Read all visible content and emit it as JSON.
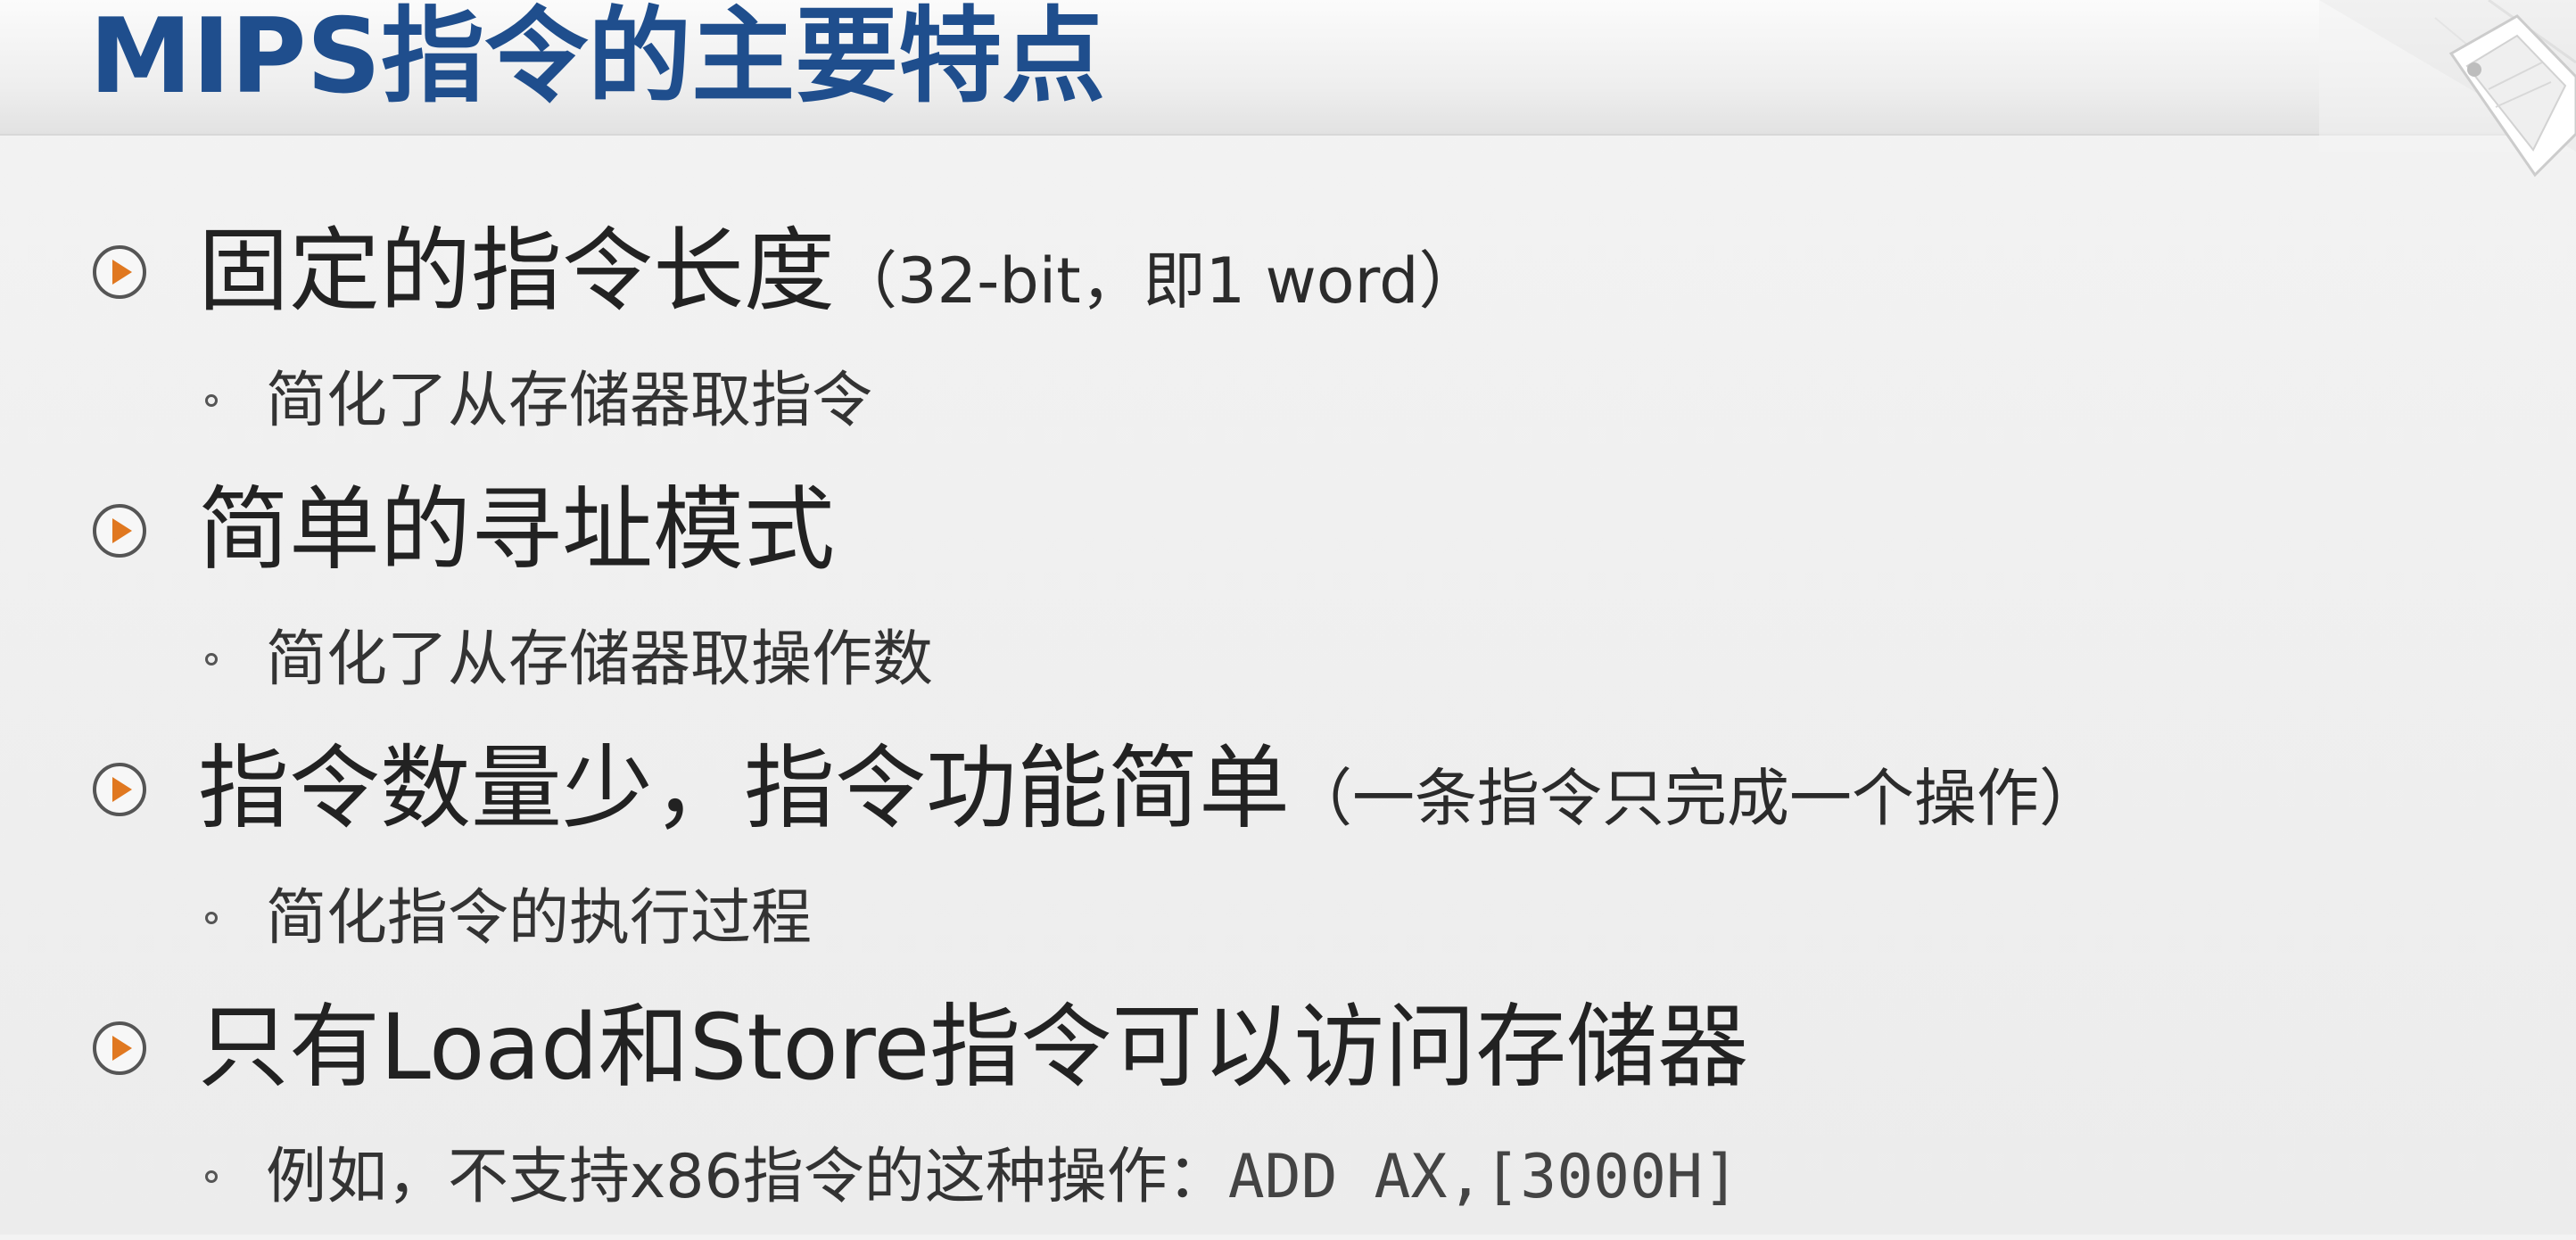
{
  "title": "MIPS指令的主要特点",
  "bullets": [
    {
      "icon": "play-circle-icon",
      "text": "固定的指令长度",
      "paren": "（32-bit，即1 word）",
      "sub": {
        "text": "简化了从存储器取指令"
      }
    },
    {
      "icon": "play-circle-icon",
      "text": "简单的寻址模式",
      "paren": "",
      "sub": {
        "text": "简化了从存储器取操作数"
      }
    },
    {
      "icon": "play-circle-icon",
      "text": "指令数量少，指令功能简单",
      "paren": "（一条指令只完成一个操作）",
      "sub": {
        "text": "简化指令的执行过程"
      }
    },
    {
      "icon": "play-circle-icon",
      "text": "只有Load和Store指令可以访问存储器",
      "paren": "",
      "sub": {
        "text": "例如，不支持x86指令的这种操作：",
        "code": "ADD AX,[3000H]"
      }
    }
  ],
  "colors": {
    "title": "#1f4e8d",
    "bullet_accent": "#e07820",
    "text": "#222222"
  }
}
